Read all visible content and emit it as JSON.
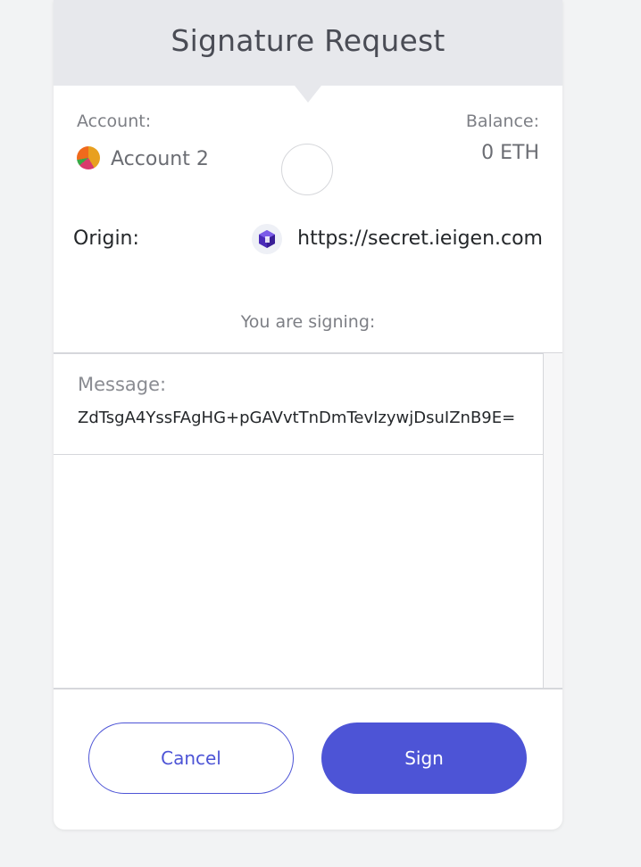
{
  "header": {
    "title": "Signature Request"
  },
  "account": {
    "label": "Account:",
    "name": "Account 2"
  },
  "balance": {
    "label": "Balance:",
    "value": "0 ETH"
  },
  "origin": {
    "label": "Origin:",
    "url": "https://secret.ieigen.com",
    "icon": "site-favicon-icon"
  },
  "signing": {
    "label": "You are signing:"
  },
  "message": {
    "label": "Message:",
    "value": "ZdTsgA4YssFAgHG+pGAVvtTnDmTevIzywjDsuIZnB9E="
  },
  "actions": {
    "cancel_label": "Cancel",
    "sign_label": "Sign"
  },
  "colors": {
    "accent": "#4d54d6",
    "header_bg": "#e7e8ec",
    "page_bg": "#f2f3f4"
  }
}
